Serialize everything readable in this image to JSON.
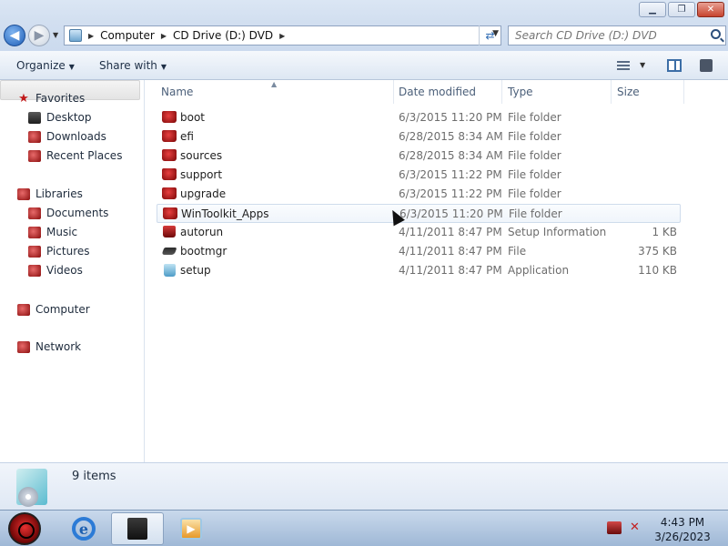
{
  "window": {
    "minimize_icon": "minimize-icon",
    "maximize_icon": "restore-icon",
    "close_icon": "close-icon"
  },
  "address": {
    "crumbs": [
      "Computer",
      "CD Drive (D:) DVD"
    ],
    "search_placeholder": "Search CD Drive (D:) DVD"
  },
  "toolbar": {
    "organize": "Organize",
    "share": "Share with"
  },
  "nav": {
    "favorites": "Favorites",
    "desktop": "Desktop",
    "downloads": "Downloads",
    "recent": "Recent Places",
    "libraries": "Libraries",
    "documents": "Documents",
    "music": "Music",
    "pictures": "Pictures",
    "videos": "Videos",
    "computer": "Computer",
    "network": "Network"
  },
  "columns": {
    "name": "Name",
    "date": "Date modified",
    "type": "Type",
    "size": "Size"
  },
  "files": [
    {
      "name": "boot",
      "date": "6/3/2015 11:20 PM",
      "type": "File folder",
      "size": ""
    },
    {
      "name": "efi",
      "date": "6/28/2015 8:34 AM",
      "type": "File folder",
      "size": ""
    },
    {
      "name": "sources",
      "date": "6/28/2015 8:34 AM",
      "type": "File folder",
      "size": ""
    },
    {
      "name": "support",
      "date": "6/3/2015 11:22 PM",
      "type": "File folder",
      "size": ""
    },
    {
      "name": "upgrade",
      "date": "6/3/2015 11:22 PM",
      "type": "File folder",
      "size": ""
    },
    {
      "name": "WinToolkit_Apps",
      "date": "6/3/2015 11:20 PM",
      "type": "File folder",
      "size": ""
    },
    {
      "name": "autorun",
      "date": "4/11/2011 8:47 PM",
      "type": "Setup Information",
      "size": "1 KB"
    },
    {
      "name": "bootmgr",
      "date": "4/11/2011 8:47 PM",
      "type": "File",
      "size": "375 KB"
    },
    {
      "name": "setup",
      "date": "4/11/2011 8:47 PM",
      "type": "Application",
      "size": "110 KB"
    }
  ],
  "details": {
    "count": "9 items"
  },
  "taskbar": {
    "time": "4:43 PM",
    "date": "3/26/2023"
  }
}
